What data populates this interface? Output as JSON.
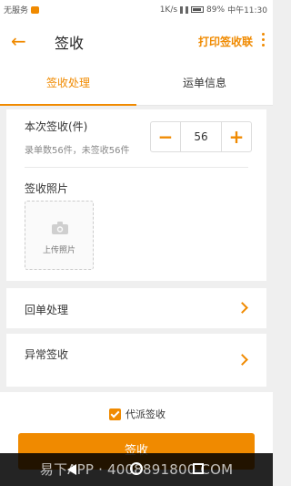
{
  "status": {
    "carrier": "无服务",
    "right_text": "1K/s",
    "battery": "89%",
    "time": "中午11:30"
  },
  "toolbar": {
    "title": "签收",
    "print_label": "打印签收联"
  },
  "tabs": [
    {
      "label": "签收处理",
      "active": true
    },
    {
      "label": "运单信息",
      "active": false
    }
  ],
  "sign_form": {
    "quantity_label": "本次签收(件)",
    "quantity_info": "录单数56件，未签收56件",
    "quantity_value": "56",
    "photo_label": "签收照片",
    "upload_label": "上传照片"
  },
  "rows": {
    "return_label": "回单处理",
    "exception_label": "异常签收"
  },
  "bottom": {
    "agent_label": "代派签收",
    "agent_checked": true,
    "sign_button": "签收"
  },
  "watermark": "易下APP · 4008891800.COM",
  "colors": {
    "accent": "#f08a00"
  },
  "icons": [
    "back-arrow-icon",
    "more-vertical-icon",
    "minus-icon",
    "plus-icon",
    "camera-icon",
    "chevron-right-icon"
  ]
}
